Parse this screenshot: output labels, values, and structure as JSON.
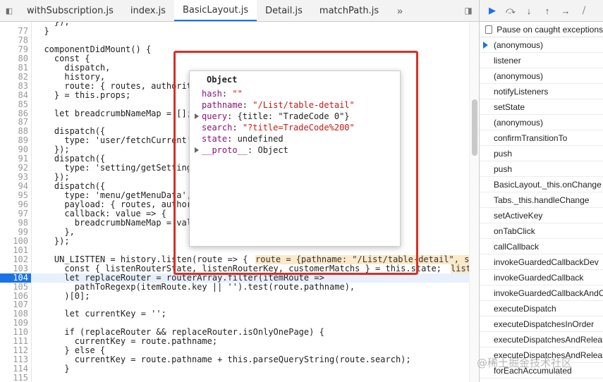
{
  "tabs": [
    {
      "label": "withSubscription.js",
      "active": false
    },
    {
      "label": "index.js",
      "active": false
    },
    {
      "label": "BasicLayout.js",
      "active": true
    },
    {
      "label": "Detail.js",
      "active": false
    },
    {
      "label": "matchPath.js",
      "active": false
    }
  ],
  "tab_more": "»",
  "code_lines": [
    {
      "n": "",
      "t": "    });"
    },
    {
      "n": "77",
      "t": "  }"
    },
    {
      "n": "78",
      "t": ""
    },
    {
      "n": "79",
      "t": "  componentDidMount() {"
    },
    {
      "n": "80",
      "t": "    const {"
    },
    {
      "n": "81",
      "t": "      dispatch,"
    },
    {
      "n": "82",
      "t": "      history,"
    },
    {
      "n": "83",
      "t": "      route: { routes, authority },"
    },
    {
      "n": "84",
      "t": "    } = this.props;"
    },
    {
      "n": "85",
      "t": ""
    },
    {
      "n": "86",
      "t": "    let breadcrumbNameMap = [];"
    },
    {
      "n": "87",
      "t": ""
    },
    {
      "n": "88",
      "t": "    dispatch({"
    },
    {
      "n": "89",
      "t": "      type: 'user/fetchCurrent',"
    },
    {
      "n": "90",
      "t": "    });"
    },
    {
      "n": "91",
      "t": "    dispatch({"
    },
    {
      "n": "92",
      "t": "      type: 'setting/getSetting',"
    },
    {
      "n": "93",
      "t": "    });"
    },
    {
      "n": "94",
      "t": "    dispatch({"
    },
    {
      "n": "95",
      "t": "      type: 'menu/getMenuData',"
    },
    {
      "n": "96",
      "t": "      payload: { routes, authority },"
    },
    {
      "n": "97",
      "t": "      callback: value => {"
    },
    {
      "n": "98",
      "t": "        breadcrumbNameMap = value;"
    },
    {
      "n": "99",
      "t": "      },"
    },
    {
      "n": "100",
      "t": "    });"
    },
    {
      "n": "101",
      "t": ""
    },
    {
      "n": "102",
      "t": "    UN_LISTTEN = history.listen(route => {"
    },
    {
      "n": "103",
      "t": "      const { listenRouterState, listenRouterKey, customerMatchs } = this.state;"
    },
    {
      "n": "104",
      "t": "      let replaceRouter = routerArray.filter(itemRoute =>",
      "current": true
    },
    {
      "n": "105",
      "t": "        pathToRegexp(itemRoute.key || '').test(route.pathname),"
    },
    {
      "n": "106",
      "t": "      )[0];"
    },
    {
      "n": "107",
      "t": ""
    },
    {
      "n": "108",
      "t": "      let currentKey = '';"
    },
    {
      "n": "109",
      "t": ""
    },
    {
      "n": "110",
      "t": "      if (replaceRouter && replaceRouter.isOnlyOnePage) {"
    },
    {
      "n": "111",
      "t": "        currentKey = route.pathname;"
    },
    {
      "n": "112",
      "t": "      } else {"
    },
    {
      "n": "113",
      "t": "        currentKey = route.pathname + this.parseQueryString(route.search);"
    },
    {
      "n": "114",
      "t": "      }"
    },
    {
      "n": "115",
      "t": ""
    }
  ],
  "inline_eval": "route = {pathname: \"/List/table-detail\", s",
  "inline_eval_2": "list",
  "popover": {
    "title": "Object",
    "props": [
      {
        "name": "hash",
        "value": "\"\"",
        "type": "str",
        "expandable": false
      },
      {
        "name": "pathname",
        "value": "\"/List/table-detail\"",
        "type": "str",
        "expandable": false
      },
      {
        "name": "query",
        "value": "{title: \"TradeCode 0\"}",
        "type": "obj",
        "expandable": true
      },
      {
        "name": "search",
        "value": "\"?title=TradeCode%200\"",
        "type": "str",
        "expandable": false
      },
      {
        "name": "state",
        "value": "undefined",
        "type": "obj",
        "expandable": false
      },
      {
        "name": "__proto__",
        "value": "Object",
        "type": "obj",
        "expandable": true
      }
    ]
  },
  "debugger": {
    "pause_on_caught": "Pause on caught exceptions",
    "call_stack": [
      "(anonymous)",
      "listener",
      "(anonymous)",
      "notifyListeners",
      "setState",
      "(anonymous)",
      "confirmTransitionTo",
      "push",
      "push",
      "BasicLayout._this.onChange",
      "Tabs._this.handleChange",
      "setActiveKey",
      "onTabClick",
      "callCallback",
      "invokeGuardedCallbackDev",
      "invokeGuardedCallback",
      "invokeGuardedCallbackAndCatchFirstError",
      "executeDispatch",
      "executeDispatchesInOrder",
      "executeDispatchesAndRelease",
      "executeDispatchesAndRelease",
      "forEachAccumulated"
    ]
  },
  "watermark": "@稀土掘金技术社区",
  "colors": {
    "accent": "#1a73e8",
    "highlight_box": "#d93025"
  }
}
